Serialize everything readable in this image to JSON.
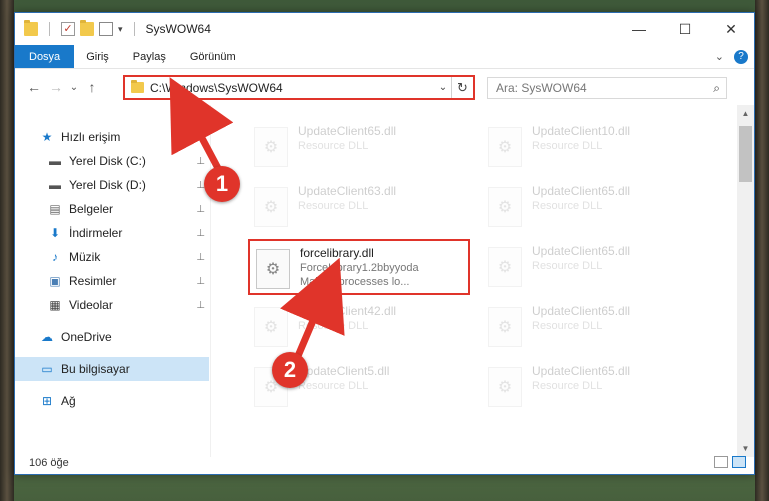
{
  "window": {
    "title": "SysWOW64",
    "minimize_glyph": "—",
    "maximize_glyph": "☐",
    "close_glyph": "✕"
  },
  "ribbon": {
    "tabs": [
      "Dosya",
      "Giriş",
      "Paylaş",
      "Görünüm"
    ],
    "active_tab": "Dosya",
    "expand_glyph": "⌄",
    "help_glyph": "?"
  },
  "nav": {
    "back_glyph": "←",
    "forward_glyph": "→",
    "recent_glyph": "⌄",
    "up_glyph": "↑",
    "address": "C:\\Windows\\SysWOW64",
    "address_dropdown_glyph": "⌄",
    "refresh_glyph": "↻",
    "search_placeholder": "Ara: SysWOW64",
    "search_glyph": "⌕"
  },
  "sidebar": {
    "items": [
      {
        "label": "Hızlı erişim",
        "icon": "star-icon",
        "glyph": "★",
        "color": "#1979ca",
        "pinned": false
      },
      {
        "label": "Yerel Disk (C:)",
        "icon": "drive-icon",
        "glyph": "▬",
        "color": "#555555",
        "pinned": true
      },
      {
        "label": "Yerel Disk (D:)",
        "icon": "drive-icon",
        "glyph": "▬",
        "color": "#555555",
        "pinned": true
      },
      {
        "label": "Belgeler",
        "icon": "documents-icon",
        "glyph": "▤",
        "color": "#666666",
        "pinned": true
      },
      {
        "label": "İndirmeler",
        "icon": "download-icon",
        "glyph": "⬇",
        "color": "#1979ca",
        "pinned": true
      },
      {
        "label": "Müzik",
        "icon": "music-icon",
        "glyph": "♪",
        "color": "#1979ca",
        "pinned": true
      },
      {
        "label": "Resimler",
        "icon": "pictures-icon",
        "glyph": "▣",
        "color": "#4a7fb5",
        "pinned": true
      },
      {
        "label": "Videolar",
        "icon": "video-icon",
        "glyph": "▦",
        "color": "#444444",
        "pinned": true
      },
      {
        "label": "OneDrive",
        "icon": "cloud-icon",
        "glyph": "☁",
        "color": "#1979ca",
        "pinned": false
      },
      {
        "label": "Bu bilgisayar",
        "icon": "computer-icon",
        "glyph": "▭",
        "color": "#1979ca",
        "pinned": false,
        "selected": true
      },
      {
        "label": "Ağ",
        "icon": "network-icon",
        "glyph": "⊞",
        "color": "#1979ca",
        "pinned": false
      }
    ],
    "pin_glyph": "📌"
  },
  "files": [
    {
      "name": "UpdateClient65.dll",
      "desc": "Resource DLL",
      "faded": true
    },
    {
      "name": "UpdateClient10.dll",
      "desc": "Resource DLL",
      "faded": true
    },
    {
      "name": "UpdateClient63.dll",
      "desc": "Resource DLL",
      "faded": true
    },
    {
      "name": "UpdateClient65.dll",
      "desc": "Resource DLL",
      "faded": true
    },
    {
      "name": "forcelibrary.dll",
      "desc": "ForceLibrary1.2bbyyoda",
      "desc2": "Making processes lo...",
      "faded": false,
      "highlighted": true
    },
    {
      "name": "UpdateClient65.dll",
      "desc": "Resource DLL",
      "faded": true
    },
    {
      "name": "UpdateClient42.dll",
      "desc": "Resource DLL",
      "faded": true
    },
    {
      "name": "UpdateClient65.dll",
      "desc": "Resource DLL",
      "faded": true
    },
    {
      "name": "UpdateClient5.dll",
      "desc": "Resource DLL",
      "faded": true
    },
    {
      "name": "UpdateClient65.dll",
      "desc": "Resource DLL",
      "faded": true
    }
  ],
  "status": {
    "count": "106 öğe"
  },
  "annotations": {
    "badge1": "1",
    "badge2": "2",
    "color": "#e0342a"
  }
}
